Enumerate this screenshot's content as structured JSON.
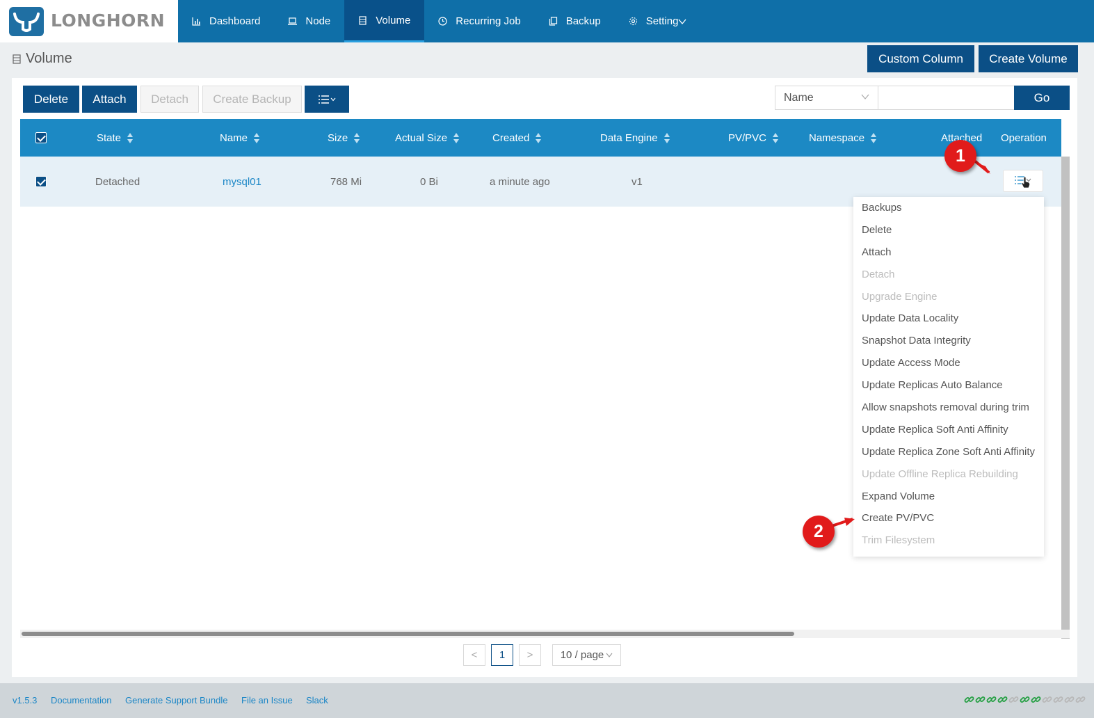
{
  "app": {
    "logo_text": "LONGHORN",
    "brand_color": "#0f6fa8"
  },
  "nav": {
    "items": [
      {
        "label": "Dashboard",
        "icon": "bar-chart-icon"
      },
      {
        "label": "Node",
        "icon": "laptop-icon"
      },
      {
        "label": "Volume",
        "icon": "database-icon",
        "active": true
      },
      {
        "label": "Recurring Job",
        "icon": "clock-icon"
      },
      {
        "label": "Backup",
        "icon": "copy-icon"
      },
      {
        "label": "Setting",
        "icon": "gear-icon"
      }
    ]
  },
  "page": {
    "title": "Volume",
    "custom_column_label": "Custom Column",
    "create_volume_label": "Create Volume"
  },
  "toolbar": {
    "delete_label": "Delete",
    "attach_label": "Attach",
    "detach_label": "Detach",
    "create_backup_label": "Create Backup",
    "search_field": "Name",
    "search_value": "",
    "go_label": "Go"
  },
  "table": {
    "columns": [
      "State",
      "Name",
      "Size",
      "Actual Size",
      "Created",
      "Data Engine",
      "PV/PVC",
      "Namespace",
      "Attached",
      "Operation"
    ],
    "rows": [
      {
        "state": "Detached",
        "name": "mysql01",
        "size": "768 Mi",
        "actual_size": "0 Bi",
        "created": "a minute ago",
        "data_engine": "v1",
        "pv_pvc": "",
        "namespace": "",
        "attached": ""
      }
    ]
  },
  "operation_menu": {
    "items": [
      {
        "label": "Backups",
        "disabled": false
      },
      {
        "label": "Delete",
        "disabled": false
      },
      {
        "label": "Attach",
        "disabled": false
      },
      {
        "label": "Detach",
        "disabled": true
      },
      {
        "label": "Upgrade Engine",
        "disabled": true
      },
      {
        "label": "Update Data Locality",
        "disabled": false
      },
      {
        "label": "Snapshot Data Integrity",
        "disabled": false
      },
      {
        "label": "Update Access Mode",
        "disabled": false
      },
      {
        "label": "Update Replicas Auto Balance",
        "disabled": false
      },
      {
        "label": "Allow snapshots removal during trim",
        "disabled": false
      },
      {
        "label": "Update Replica Soft Anti Affinity",
        "disabled": false
      },
      {
        "label": "Update Replica Zone Soft Anti Affinity",
        "disabled": false
      },
      {
        "label": "Update Offline Replica Rebuilding",
        "disabled": true
      },
      {
        "label": "Expand Volume",
        "disabled": false
      },
      {
        "label": "Create PV/PVC",
        "disabled": false
      },
      {
        "label": "Trim Filesystem",
        "disabled": true
      }
    ]
  },
  "annotations": {
    "badge_1": "1",
    "badge_2": "2",
    "badge_color": "#e11b1b"
  },
  "pagination": {
    "prev": "<",
    "current_page": "1",
    "next": ">",
    "page_size": "10 / page"
  },
  "footer": {
    "version": "v1.5.3",
    "documentation": "Documentation",
    "support_bundle": "Generate Support Bundle",
    "file_issue": "File an Issue",
    "slack": "Slack",
    "health_links": [
      "green",
      "green",
      "green",
      "green",
      "gray",
      "green",
      "green",
      "gray",
      "gray",
      "gray",
      "gray"
    ]
  }
}
